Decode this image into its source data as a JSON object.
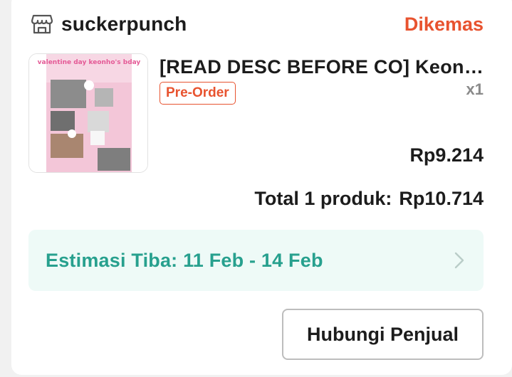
{
  "shop": {
    "name": "suckerpunch",
    "icon": "store-icon"
  },
  "order": {
    "status": "Dikemas"
  },
  "product": {
    "title": "[READ DESC BEFORE CO] Keonho Valentine's Day Pack",
    "badge": "Pre-Order",
    "quantity": "x1",
    "price": "Rp9.214",
    "thumbnail_text": "valentine day keonho's bday"
  },
  "total": {
    "label": "Total 1 produk:",
    "value": "Rp10.714"
  },
  "eta": {
    "text": "Estimasi Tiba: 11 Feb - 14 Feb",
    "icon": "chevron-right-icon"
  },
  "actions": {
    "contact_label": "Hubungi Penjual"
  },
  "colors": {
    "accent": "#e8532f",
    "eta_text": "#27a08e",
    "eta_bg": "#eefaf7"
  }
}
